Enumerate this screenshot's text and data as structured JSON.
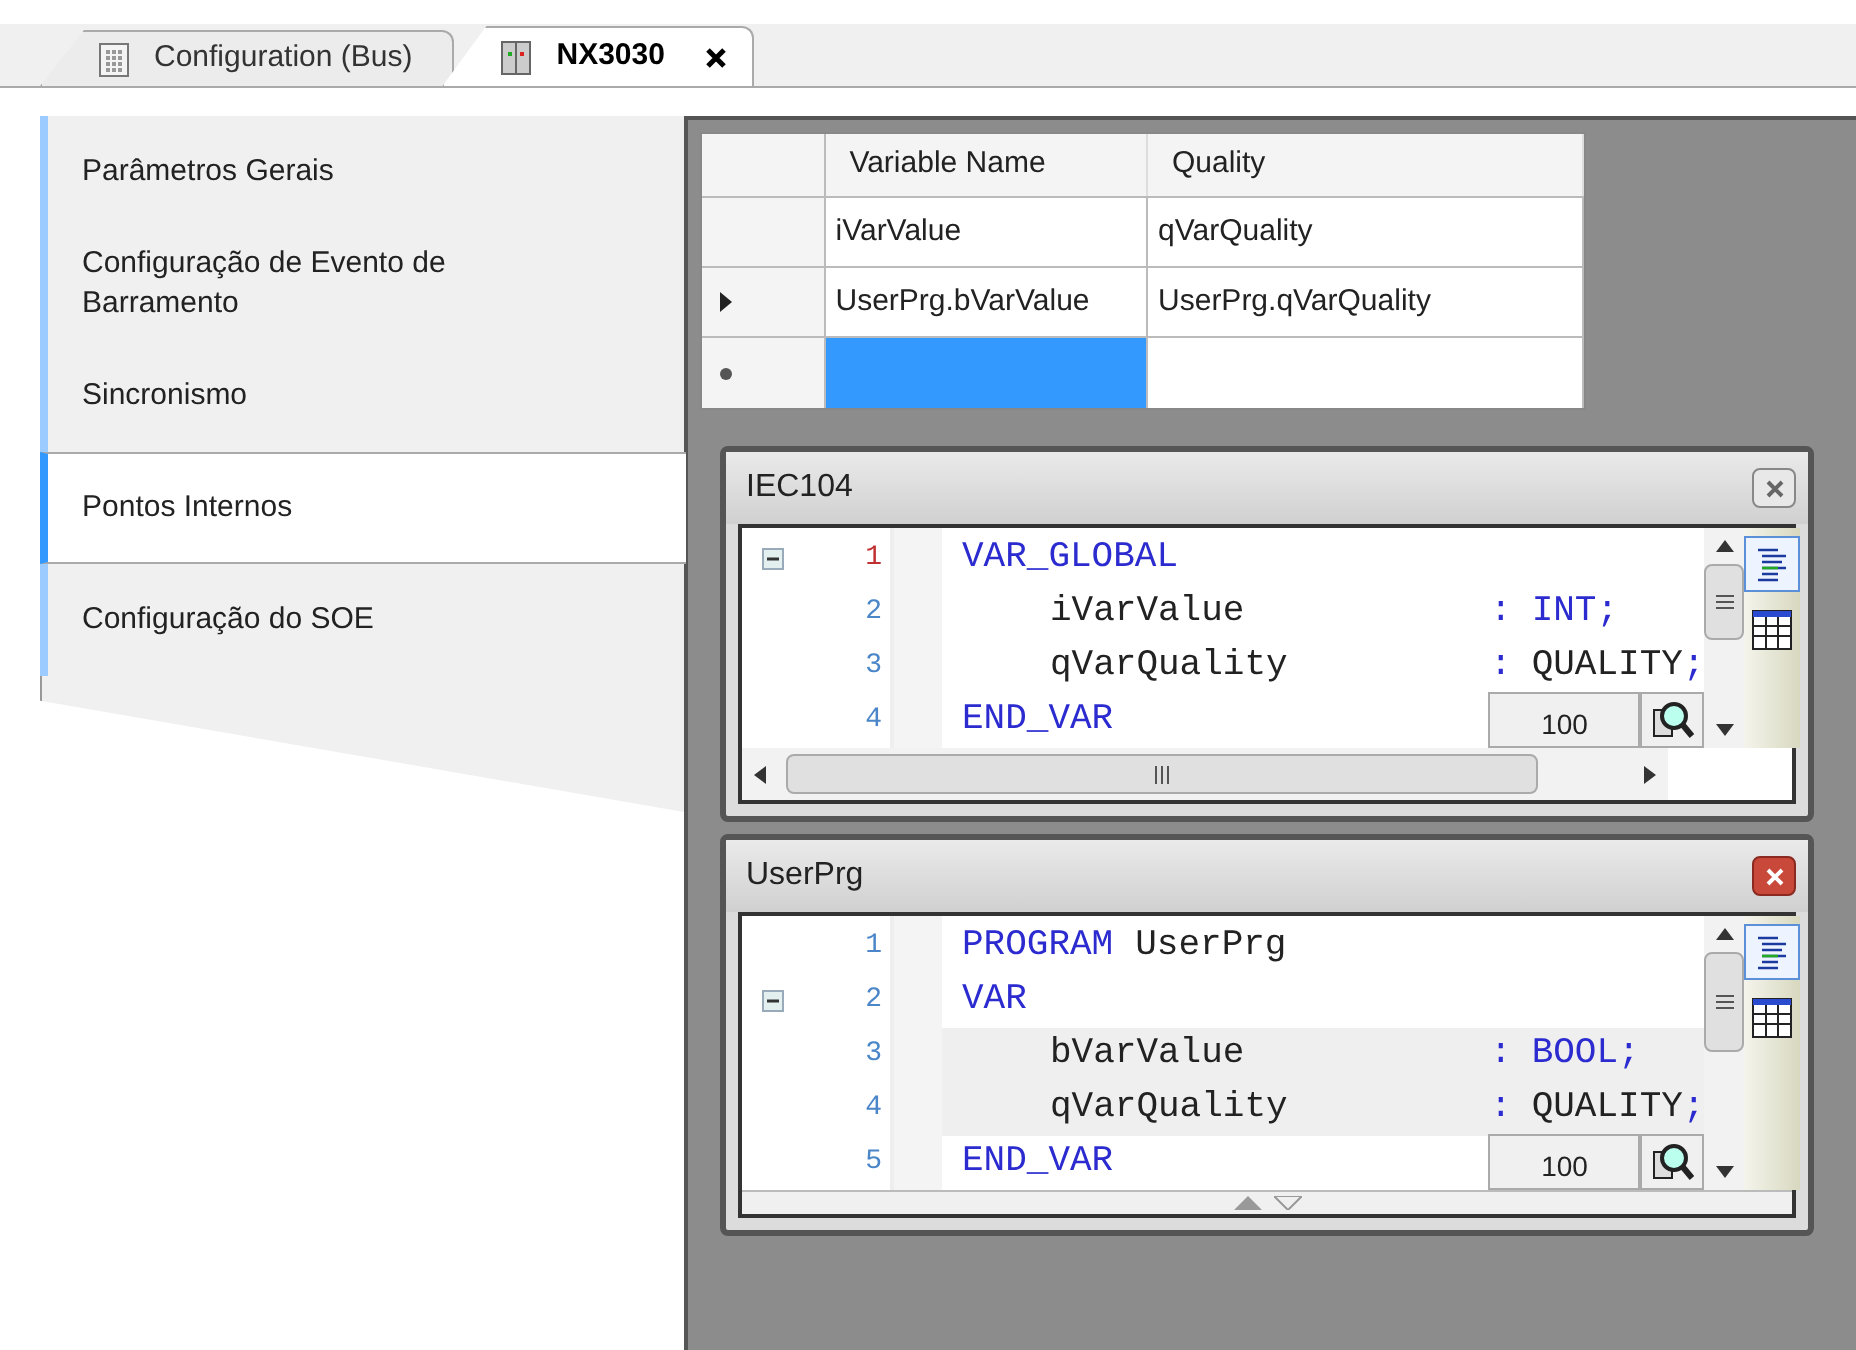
{
  "tabs": [
    {
      "label": "Configuration (Bus)",
      "kind": "config",
      "selected": false
    },
    {
      "label": "NX3030",
      "kind": "device",
      "selected": true
    }
  ],
  "sidebar": {
    "items": [
      {
        "label": "Parâmetros Gerais",
        "selected": false
      },
      {
        "label": "Configuração de Evento de Barramento",
        "selected": false
      },
      {
        "label": "Sincronismo",
        "selected": false
      },
      {
        "label": "Pontos Internos",
        "selected": true
      },
      {
        "label": "Configuração do SOE",
        "selected": false
      }
    ]
  },
  "table": {
    "columns": [
      "Variable Name",
      "Quality"
    ],
    "rows": [
      {
        "cells": [
          "iVarValue",
          "qVarQuality"
        ],
        "current": false
      },
      {
        "cells": [
          "UserPrg.bVarValue",
          "UserPrg.qVarQuality"
        ],
        "current": true
      }
    ],
    "new_row": {
      "cells": [
        {
          "selected": true
        },
        {
          "selected": false
        }
      ]
    }
  },
  "windows": [
    {
      "title": "IEC104",
      "active": false,
      "kind": "scrollbar",
      "zoom": "100",
      "lines": [
        {
          "num": "1",
          "current": true,
          "fold": true,
          "highlighted": false,
          "indented": false,
          "tokens": [
            {
              "text": "VAR_GLOBAL",
              "kind": "keyword"
            }
          ]
        },
        {
          "num": "2",
          "current": false,
          "fold": false,
          "highlighted": false,
          "indented": true,
          "tokens": [
            {
              "text": "iVarValue",
              "kind": "name"
            },
            {
              "text": ":",
              "kind": "op"
            },
            {
              "text": "INT",
              "kind": "keyword"
            },
            {
              "text": ";",
              "kind": "op"
            }
          ]
        },
        {
          "num": "3",
          "current": false,
          "fold": false,
          "highlighted": false,
          "indented": true,
          "tokens": [
            {
              "text": "qVarQuality",
              "kind": "name"
            },
            {
              "text": ":",
              "kind": "op"
            },
            {
              "text": "QUALITY",
              "kind": "ident"
            },
            {
              "text": ";",
              "kind": "op"
            }
          ]
        },
        {
          "num": "4",
          "current": false,
          "fold": false,
          "highlighted": false,
          "indented": false,
          "tokens": [
            {
              "text": "END_VAR",
              "kind": "keyword"
            }
          ]
        }
      ]
    },
    {
      "title": "UserPrg",
      "active": true,
      "kind": "splitter",
      "zoom": "100",
      "lines": [
        {
          "num": "1",
          "current": false,
          "fold": false,
          "highlighted": false,
          "indented": false,
          "tokens": [
            {
              "text": "PROGRAM",
              "kind": "keyword"
            },
            {
              "text": "UserPrg",
              "kind": "ident"
            }
          ]
        },
        {
          "num": "2",
          "current": false,
          "fold": true,
          "highlighted": false,
          "indented": false,
          "tokens": [
            {
              "text": "VAR",
              "kind": "keyword"
            }
          ]
        },
        {
          "num": "3",
          "current": false,
          "fold": false,
          "highlighted": true,
          "indented": true,
          "tokens": [
            {
              "text": "bVarValue",
              "kind": "name"
            },
            {
              "text": ":",
              "kind": "op"
            },
            {
              "text": "BOOL",
              "kind": "keyword"
            },
            {
              "text": ";",
              "kind": "op"
            }
          ]
        },
        {
          "num": "4",
          "current": false,
          "fold": false,
          "highlighted": true,
          "indented": true,
          "tokens": [
            {
              "text": "qVarQuality",
              "kind": "name"
            },
            {
              "text": ":",
              "kind": "op"
            },
            {
              "text": "QUALITY",
              "kind": "ident"
            },
            {
              "text": ";",
              "kind": "op"
            }
          ]
        },
        {
          "num": "5",
          "current": false,
          "fold": false,
          "highlighted": false,
          "indented": false,
          "tokens": [
            {
              "text": "END_VAR",
              "kind": "keyword"
            }
          ]
        }
      ]
    }
  ]
}
